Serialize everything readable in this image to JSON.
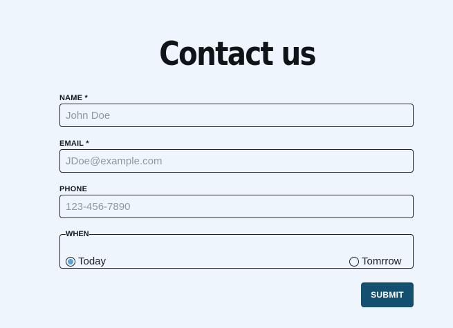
{
  "page": {
    "title": "Contact us"
  },
  "form": {
    "name": {
      "label": "NAME *",
      "value": "",
      "placeholder": "John Doe"
    },
    "email": {
      "label": "EMAIL *",
      "value": "",
      "placeholder": "JDoe@example.com"
    },
    "phone": {
      "label": "PHONE",
      "value": "",
      "placeholder": "123-456-7890"
    },
    "when": {
      "legend": "WHEN",
      "options": [
        {
          "label": "Today",
          "selected": true
        },
        {
          "label": "Tomrrow",
          "selected": false
        }
      ]
    },
    "submit_label": "SUBMIT"
  },
  "colors": {
    "background": "#eef5fc",
    "accent": "#13506f",
    "radio_selected": "#5aa2d8",
    "border": "#1c2228"
  }
}
